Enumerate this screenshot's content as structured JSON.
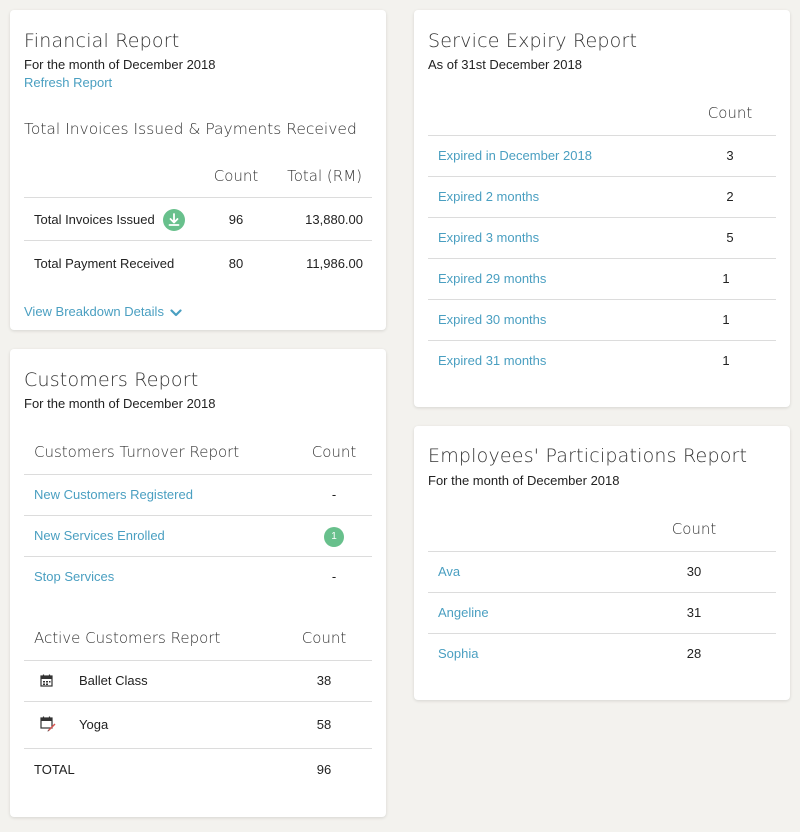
{
  "financial": {
    "title": "Financial Report",
    "subtitle": "For the month of December 2018",
    "refresh_label": "Refresh Report",
    "section_title": "Total Invoices Issued & Payments Received",
    "col_count": "Count",
    "col_total": "Total (RM)",
    "rows": [
      {
        "label": "Total Invoices Issued",
        "count": "96",
        "total": "13,880.00"
      },
      {
        "label": "Total Payment Received",
        "count": "80",
        "total": "11,986.00"
      }
    ],
    "breakdown_label": "View Breakdown Details"
  },
  "customers": {
    "title": "Customers Report",
    "subtitle": "For the month of December 2018",
    "turnover_header": "Customers Turnover Report",
    "turnover_count_header": "Count",
    "turnover_rows": [
      {
        "label": "New Customers Registered",
        "count": "-"
      },
      {
        "label": "New Services Enrolled",
        "count": "1"
      },
      {
        "label": "Stop Services",
        "count": "-"
      }
    ],
    "active_header": "Active Customers Report",
    "active_count_header": "Count",
    "active_rows": [
      {
        "label": "Ballet Class",
        "count": "38",
        "icon": "calendar-icon"
      },
      {
        "label": "Yoga",
        "count": "58",
        "icon": "calendar-edit-icon"
      }
    ],
    "total_label": "TOTAL",
    "total_count": "96"
  },
  "service_expiry": {
    "title": "Service Expiry Report",
    "subtitle": "As of 31st December 2018",
    "count_header": "Count",
    "rows": [
      {
        "label": "Expired in December 2018",
        "count": "3"
      },
      {
        "label": "Expired 2 months",
        "count": "2"
      },
      {
        "label": "Expired 3 months",
        "count": "5"
      },
      {
        "label": "Expired 29 months",
        "count": "1"
      },
      {
        "label": "Expired 30 months",
        "count": "1"
      },
      {
        "label": "Expired 31 months",
        "count": "1"
      }
    ]
  },
  "employees": {
    "title": "Employees' Participations Report",
    "subtitle": "For the month of December 2018",
    "count_header": "Count",
    "rows": [
      {
        "label": "Ava",
        "count": "30"
      },
      {
        "label": "Angeline",
        "count": "31"
      },
      {
        "label": "Sophia",
        "count": "28"
      }
    ]
  },
  "colors": {
    "link": "#4a9fc1",
    "badge": "#68c08c",
    "background": "#f3f2ee"
  }
}
